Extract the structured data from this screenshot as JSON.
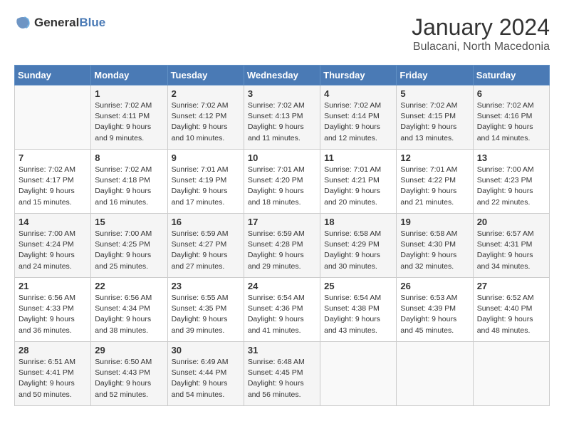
{
  "logo": {
    "general": "General",
    "blue": "Blue"
  },
  "header": {
    "month": "January 2024",
    "location": "Bulacani, North Macedonia"
  },
  "weekdays": [
    "Sunday",
    "Monday",
    "Tuesday",
    "Wednesday",
    "Thursday",
    "Friday",
    "Saturday"
  ],
  "weeks": [
    [
      {
        "day": "",
        "sunrise": "",
        "sunset": "",
        "daylight": ""
      },
      {
        "day": "1",
        "sunrise": "Sunrise: 7:02 AM",
        "sunset": "Sunset: 4:11 PM",
        "daylight": "Daylight: 9 hours and 9 minutes."
      },
      {
        "day": "2",
        "sunrise": "Sunrise: 7:02 AM",
        "sunset": "Sunset: 4:12 PM",
        "daylight": "Daylight: 9 hours and 10 minutes."
      },
      {
        "day": "3",
        "sunrise": "Sunrise: 7:02 AM",
        "sunset": "Sunset: 4:13 PM",
        "daylight": "Daylight: 9 hours and 11 minutes."
      },
      {
        "day": "4",
        "sunrise": "Sunrise: 7:02 AM",
        "sunset": "Sunset: 4:14 PM",
        "daylight": "Daylight: 9 hours and 12 minutes."
      },
      {
        "day": "5",
        "sunrise": "Sunrise: 7:02 AM",
        "sunset": "Sunset: 4:15 PM",
        "daylight": "Daylight: 9 hours and 13 minutes."
      },
      {
        "day": "6",
        "sunrise": "Sunrise: 7:02 AM",
        "sunset": "Sunset: 4:16 PM",
        "daylight": "Daylight: 9 hours and 14 minutes."
      }
    ],
    [
      {
        "day": "7",
        "sunrise": "Sunrise: 7:02 AM",
        "sunset": "Sunset: 4:17 PM",
        "daylight": "Daylight: 9 hours and 15 minutes."
      },
      {
        "day": "8",
        "sunrise": "Sunrise: 7:02 AM",
        "sunset": "Sunset: 4:18 PM",
        "daylight": "Daylight: 9 hours and 16 minutes."
      },
      {
        "day": "9",
        "sunrise": "Sunrise: 7:01 AM",
        "sunset": "Sunset: 4:19 PM",
        "daylight": "Daylight: 9 hours and 17 minutes."
      },
      {
        "day": "10",
        "sunrise": "Sunrise: 7:01 AM",
        "sunset": "Sunset: 4:20 PM",
        "daylight": "Daylight: 9 hours and 18 minutes."
      },
      {
        "day": "11",
        "sunrise": "Sunrise: 7:01 AM",
        "sunset": "Sunset: 4:21 PM",
        "daylight": "Daylight: 9 hours and 20 minutes."
      },
      {
        "day": "12",
        "sunrise": "Sunrise: 7:01 AM",
        "sunset": "Sunset: 4:22 PM",
        "daylight": "Daylight: 9 hours and 21 minutes."
      },
      {
        "day": "13",
        "sunrise": "Sunrise: 7:00 AM",
        "sunset": "Sunset: 4:23 PM",
        "daylight": "Daylight: 9 hours and 22 minutes."
      }
    ],
    [
      {
        "day": "14",
        "sunrise": "Sunrise: 7:00 AM",
        "sunset": "Sunset: 4:24 PM",
        "daylight": "Daylight: 9 hours and 24 minutes."
      },
      {
        "day": "15",
        "sunrise": "Sunrise: 7:00 AM",
        "sunset": "Sunset: 4:25 PM",
        "daylight": "Daylight: 9 hours and 25 minutes."
      },
      {
        "day": "16",
        "sunrise": "Sunrise: 6:59 AM",
        "sunset": "Sunset: 4:27 PM",
        "daylight": "Daylight: 9 hours and 27 minutes."
      },
      {
        "day": "17",
        "sunrise": "Sunrise: 6:59 AM",
        "sunset": "Sunset: 4:28 PM",
        "daylight": "Daylight: 9 hours and 29 minutes."
      },
      {
        "day": "18",
        "sunrise": "Sunrise: 6:58 AM",
        "sunset": "Sunset: 4:29 PM",
        "daylight": "Daylight: 9 hours and 30 minutes."
      },
      {
        "day": "19",
        "sunrise": "Sunrise: 6:58 AM",
        "sunset": "Sunset: 4:30 PM",
        "daylight": "Daylight: 9 hours and 32 minutes."
      },
      {
        "day": "20",
        "sunrise": "Sunrise: 6:57 AM",
        "sunset": "Sunset: 4:31 PM",
        "daylight": "Daylight: 9 hours and 34 minutes."
      }
    ],
    [
      {
        "day": "21",
        "sunrise": "Sunrise: 6:56 AM",
        "sunset": "Sunset: 4:33 PM",
        "daylight": "Daylight: 9 hours and 36 minutes."
      },
      {
        "day": "22",
        "sunrise": "Sunrise: 6:56 AM",
        "sunset": "Sunset: 4:34 PM",
        "daylight": "Daylight: 9 hours and 38 minutes."
      },
      {
        "day": "23",
        "sunrise": "Sunrise: 6:55 AM",
        "sunset": "Sunset: 4:35 PM",
        "daylight": "Daylight: 9 hours and 39 minutes."
      },
      {
        "day": "24",
        "sunrise": "Sunrise: 6:54 AM",
        "sunset": "Sunset: 4:36 PM",
        "daylight": "Daylight: 9 hours and 41 minutes."
      },
      {
        "day": "25",
        "sunrise": "Sunrise: 6:54 AM",
        "sunset": "Sunset: 4:38 PM",
        "daylight": "Daylight: 9 hours and 43 minutes."
      },
      {
        "day": "26",
        "sunrise": "Sunrise: 6:53 AM",
        "sunset": "Sunset: 4:39 PM",
        "daylight": "Daylight: 9 hours and 45 minutes."
      },
      {
        "day": "27",
        "sunrise": "Sunrise: 6:52 AM",
        "sunset": "Sunset: 4:40 PM",
        "daylight": "Daylight: 9 hours and 48 minutes."
      }
    ],
    [
      {
        "day": "28",
        "sunrise": "Sunrise: 6:51 AM",
        "sunset": "Sunset: 4:41 PM",
        "daylight": "Daylight: 9 hours and 50 minutes."
      },
      {
        "day": "29",
        "sunrise": "Sunrise: 6:50 AM",
        "sunset": "Sunset: 4:43 PM",
        "daylight": "Daylight: 9 hours and 52 minutes."
      },
      {
        "day": "30",
        "sunrise": "Sunrise: 6:49 AM",
        "sunset": "Sunset: 4:44 PM",
        "daylight": "Daylight: 9 hours and 54 minutes."
      },
      {
        "day": "31",
        "sunrise": "Sunrise: 6:48 AM",
        "sunset": "Sunset: 4:45 PM",
        "daylight": "Daylight: 9 hours and 56 minutes."
      },
      {
        "day": "",
        "sunrise": "",
        "sunset": "",
        "daylight": ""
      },
      {
        "day": "",
        "sunrise": "",
        "sunset": "",
        "daylight": ""
      },
      {
        "day": "",
        "sunrise": "",
        "sunset": "",
        "daylight": ""
      }
    ]
  ]
}
